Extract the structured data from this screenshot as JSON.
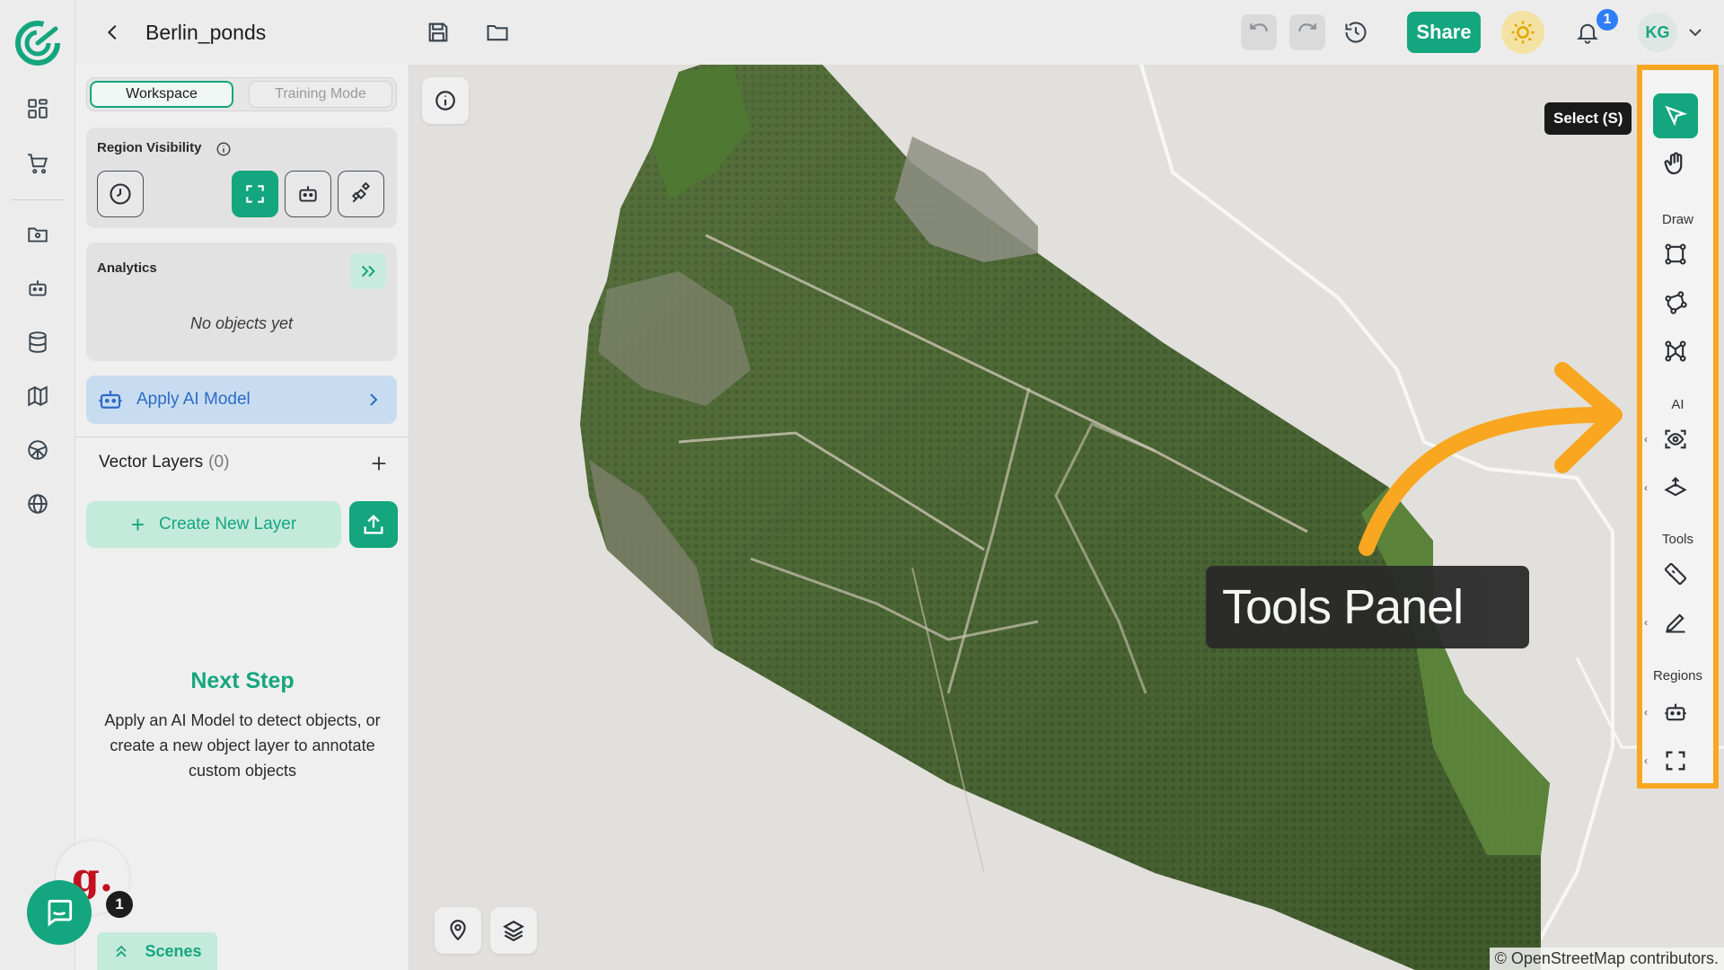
{
  "app": {
    "project_title": "Berlin_ponds"
  },
  "topbar": {
    "share_label": "Share",
    "notification_count": "1",
    "user_initials": "KG"
  },
  "panel": {
    "tabs": [
      {
        "label": "Workspace",
        "active": true
      },
      {
        "label": "Training Mode",
        "active": false
      }
    ],
    "region_visibility": {
      "title": "Region Visibility"
    },
    "analytics": {
      "title": "Analytics",
      "empty_text": "No objects yet"
    },
    "apply_ai_model": "Apply AI Model",
    "vector_layers": {
      "title": "Vector Layers",
      "count": "(0)"
    },
    "create_new_layer": "Create New Layer",
    "next_step": {
      "title": "Next Step",
      "text": "Apply an AI Model to detect objects, or create a new object layer to annotate custom objects"
    },
    "scenes_label": "Scenes"
  },
  "widgets": {
    "grammarly_letter": "g.",
    "chat_badge": "1"
  },
  "map": {
    "attribution": "© OpenStreetMap contributors."
  },
  "tools_panel": {
    "tooltip": "Select (S)",
    "sections": {
      "draw": "Draw",
      "ai": "AI",
      "tools": "Tools",
      "regions": "Regions"
    },
    "callout": "Tools Panel"
  },
  "colors": {
    "brand": "#14a67e",
    "highlight": "#f9a620",
    "apply_bg": "#c8dcf1",
    "apply_text": "#2d6bc7",
    "notification": "#2f7ef5"
  }
}
